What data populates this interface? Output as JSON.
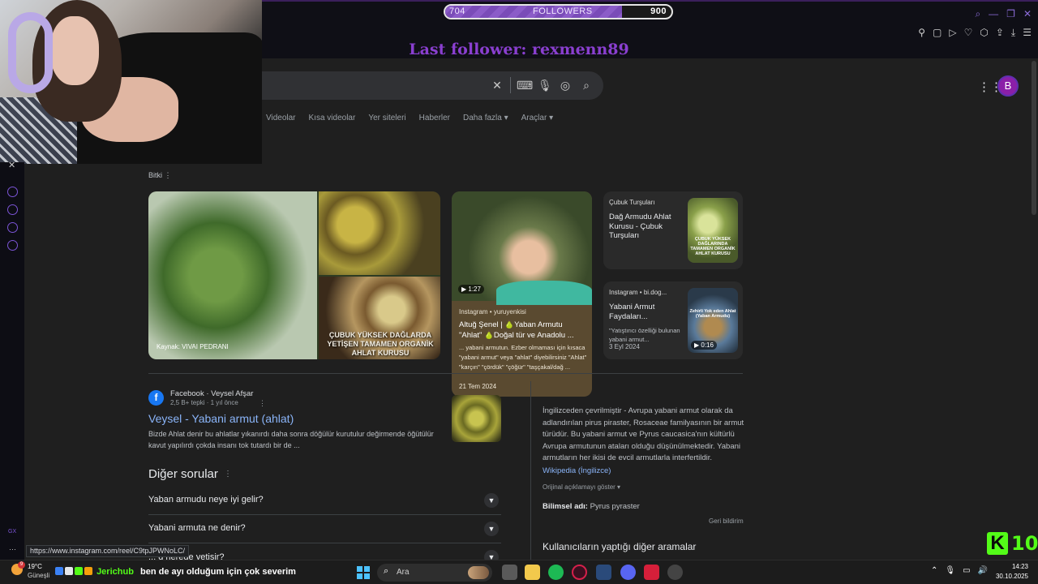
{
  "overlay": {
    "followers_current": "704",
    "followers_label": "FOLLOWERS",
    "followers_goal": "900",
    "followers_progress": 0.78,
    "last_follower": "Last follower: rexmenn89"
  },
  "search": {
    "query": "",
    "tabs": [
      "Videolar",
      "Kısa videolar",
      "Yer siteleri",
      "Haberler",
      "Daha fazla ▾",
      "Araçlar ▾"
    ],
    "avatar_letter": "B"
  },
  "bitki_label": "Bitki",
  "images": {
    "source_caption": "Kaynak: VIVAI PEDRANI",
    "overlay_caption": "ÇUBUK YÜKSEK DAĞLARDA YETİŞEN TAMAMEN ORGANİK AHLAT KURUSU"
  },
  "video_card": {
    "duration": "1:27",
    "source": "Instagram • yuruyenkisi",
    "title": "Altuğ Şenel | 🍐Yaban Armutu \"Ahlat\" 🍐Doğal tür ve Anadolu ...",
    "snippet": "... yabani armutun. Ezber olmaması için kısaca \"yabani armut\" veya \"ahlat\" diyebilirsiniz \"Ahlat\" \"karçın\" \"çördük\" \"çöğür\" \"taşçakal/dağ ...",
    "date": "21 Tem 2024"
  },
  "side_cards": [
    {
      "source": "Çubuk Turşuları",
      "title": "Dağ Armudu Ahlat Kurusu - Çubuk Turşuları",
      "thumb_text": "ÇUBUK YÜKSEK DAĞLARINDA TAMAMEN ORGANİK AHLAT KURUSU"
    },
    {
      "source": "Instagram • bi.dog...",
      "title": "Yabani Armut Faydaları...",
      "snippet": "\"Yatıştırıcı özelliği bulunan yabani armut...",
      "date": "3 Eyl 2024",
      "duration": "0:16",
      "thumb_text": "Zehirli Yok eden Ahlat (Yaban Armudu)"
    }
  ],
  "facebook_result": {
    "site": "Facebook · Veysel Afşar",
    "meta": "2,5 B+ tepki · 1 yıl önce",
    "title": "Veysel - Yabani armut (ahlat)",
    "snippet": "Bizde Ahlat denir bu ahlatlar yıkanırdı daha sonra döğülür kurutulur değirmende öğütülür kavut yapılırdı çokda insanı tok tutardı bir de ..."
  },
  "paa": {
    "title": "Diğer sorular",
    "questions": [
      "Yaban armudu neye iyi gelir?",
      "Yabani armuta ne denir?",
      "... d nerede yetişir?"
    ]
  },
  "knowledge_panel": {
    "text": "İngilizceden çevrilmiştir - Avrupa yabani armut olarak da adlandırılan pirus piraster, Rosaceae familyasının bir armut türüdür. Bu yabani armut ve Pyrus caucasica'nın kültürlü Avrupa armutunun ataları olduğu düşünülmektedir. Yabani armutların her ikisi de evcil armutlarla interfertildir.",
    "link": "Wikipedia (İngilizce)",
    "show_original": "Orijinal açıklamayı göster ▾",
    "sci_label": "Bilimsel adı:",
    "sci_value": "Pyrus pyraster",
    "feedback": "Geri bildirim",
    "other_searches": "Kullanıcıların yaptığı diğer aramalar"
  },
  "kick_badge": {
    "letter": "K",
    "number": "10"
  },
  "status_url": "https://www.instagram.com/reel/C9tpJPWNoLC/",
  "taskbar": {
    "weather_temp": "19°C",
    "weather_desc": "Güneşli",
    "weather_badge": "9",
    "chat_user": "Jerichub",
    "chat_message": "ben de ayı olduğum için çok severim",
    "search_placeholder": "Ara",
    "time": "14:23",
    "date": "30.10.2025"
  },
  "colors": {
    "accent_purple": "#8a3fd0",
    "kick_green": "#53fc18",
    "link_blue": "#8ab4f8"
  }
}
